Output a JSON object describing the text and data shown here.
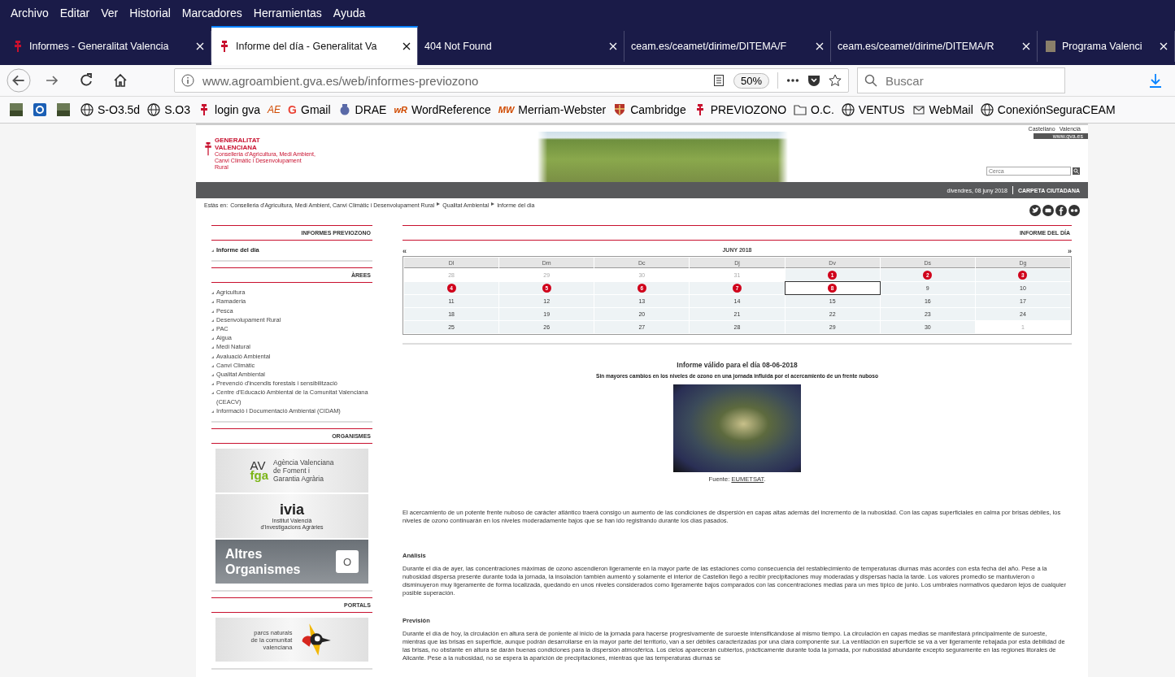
{
  "menu_bar": [
    "Archivo",
    "Editar",
    "Ver",
    "Historial",
    "Marcadores",
    "Herramientas",
    "Ayuda"
  ],
  "tabs": [
    {
      "title": "Informes - Generalitat Valencia",
      "kind": "gva",
      "selected": false
    },
    {
      "title": "Informe del día - Generalitat Va",
      "kind": "gva",
      "selected": true
    },
    {
      "title": "404 Not Found",
      "kind": "plain",
      "selected": false
    },
    {
      "title": "ceam.es/ceamet/dirime/DITEMA/F",
      "kind": "plain",
      "selected": false
    },
    {
      "title": "ceam.es/ceamet/dirime/DITEMA/R",
      "kind": "plain",
      "selected": false
    },
    {
      "title": "Programa Valenci",
      "kind": "page",
      "selected": false
    }
  ],
  "address_bar": {
    "url": "www.agroambient.gva.es/web/informes-previozono",
    "zoom": "50%"
  },
  "search": {
    "placeholder": "Buscar"
  },
  "bookmarks": [
    {
      "kind": "photo"
    },
    {
      "kind": "ring"
    },
    {
      "kind": "photo"
    },
    {
      "label": "S-O3.5d",
      "kind": "globe"
    },
    {
      "label": "S.O3",
      "kind": "globe"
    },
    {
      "label": "login gva",
      "kind": "gva"
    },
    {
      "label": "Gmail",
      "kind": "logo",
      "logo_text": "G"
    },
    {
      "label": "DRAE",
      "kind": "crest"
    },
    {
      "label": "WordReference",
      "kind": "logo",
      "logo_text": "wR"
    },
    {
      "label": "Merriam-Webster",
      "kind": "logo",
      "logo_text": "MW"
    },
    {
      "label": "Cambridge",
      "kind": "shield"
    },
    {
      "label": "PREVIOZONO",
      "kind": "gva"
    },
    {
      "label": "O.C.",
      "kind": "folder"
    },
    {
      "label": "VENTUS",
      "kind": "globe"
    },
    {
      "label": "WebMail",
      "kind": "mail"
    },
    {
      "label": "ConexiónSeguraCEAM",
      "kind": "globe"
    }
  ],
  "ae_bookmark": "AE",
  "page": {
    "languages": [
      "Castellano",
      "Valencià"
    ],
    "site_link": "www.gva.es",
    "logo": {
      "name_lines": [
        "GENERALITAT",
        "VALENCIANA"
      ],
      "department": "Conselleria d'Agricultura, Medi Ambient, Canvi Climàtic i Desenvolupament Rural"
    },
    "search_placeholder": "Cerca",
    "date": "divendres, 08 juny 2018",
    "citizen_link": "CARPETA CIUTADANA",
    "breadcrumb": {
      "label": "Estàs en:",
      "items": [
        "Conselleria d'Agricultura, Medi Ambient, Canvi Climàtic i Desenvolupament Rural",
        "Qualitat Ambiental",
        "Informe del dia"
      ]
    },
    "sidebar": [
      {
        "title": "INFORMES PREVIOZONO",
        "kind": "links",
        "items": [
          {
            "label": "Informe del dia",
            "selected": true
          }
        ]
      },
      {
        "title": "ÀREES",
        "kind": "links",
        "items": [
          {
            "label": "Agricultura",
            "selected": false
          },
          {
            "label": "Ramaderia",
            "selected": false
          },
          {
            "label": "Pesca",
            "selected": false
          },
          {
            "label": "Desenvolupament Rural",
            "selected": false
          },
          {
            "label": "PAC",
            "selected": false
          },
          {
            "label": "Aigua",
            "selected": false
          },
          {
            "label": "Medi Natural",
            "selected": false
          },
          {
            "label": "Avaluació Ambiental",
            "selected": false
          },
          {
            "label": "Canvi Climàtic",
            "selected": false
          },
          {
            "label": "Qualitat Ambiental",
            "selected": false
          },
          {
            "label": "Prevenció d'incendis forestals i sensibilització",
            "selected": false
          },
          {
            "label": "Centre d'Educació Ambiental de la Comunitat Valenciana (CEACV)",
            "selected": false
          },
          {
            "label": "Informació i Documentació Ambiental (CIDAM)",
            "selected": false
          }
        ]
      },
      {
        "title": "ORGANISMES",
        "kind": "banners",
        "items": [
          {
            "kind": "avfga",
            "mark_top": "AV",
            "mark_bottom": "fga",
            "lines": [
              "Agència Valenciana",
              "de Foment i",
              "Garantia Agrària"
            ]
          },
          {
            "kind": "ivia",
            "mark_top": "ivia",
            "lines": [
              "Institut Valencià",
              "d'Investigacions Agràries"
            ]
          },
          {
            "kind": "others",
            "lines": [
              "Altres",
              "Organismes"
            ],
            "badge": "O"
          }
        ]
      },
      {
        "title": "PORTALS",
        "kind": "banners",
        "items": [
          {
            "kind": "parks",
            "lines": [
              "parcs naturals",
              "de la comunitat",
              "valenciana"
            ]
          }
        ]
      }
    ],
    "calendar": {
      "title": "INFORME DEL DÍA",
      "prev": "«",
      "next": "»",
      "month": "JUNY 2018",
      "weekdays": [
        "Dl",
        "Dm",
        "Dc",
        "Dj",
        "Dv",
        "Ds",
        "Dg"
      ],
      "weeks": [
        [
          {
            "day": "28",
            "kind": "outside",
            "selected": false
          },
          {
            "day": "29",
            "kind": "outside",
            "selected": false
          },
          {
            "day": "30",
            "kind": "outside",
            "selected": false
          },
          {
            "day": "31",
            "kind": "outside",
            "selected": false
          },
          {
            "day": "1",
            "kind": "report",
            "selected": false
          },
          {
            "day": "2",
            "kind": "report",
            "selected": false
          },
          {
            "day": "3",
            "kind": "report",
            "selected": false
          }
        ],
        [
          {
            "day": "4",
            "kind": "report",
            "selected": false
          },
          {
            "day": "5",
            "kind": "report",
            "selected": false
          },
          {
            "day": "6",
            "kind": "report",
            "selected": false
          },
          {
            "day": "7",
            "kind": "report",
            "selected": false
          },
          {
            "day": "8",
            "kind": "report",
            "selected": true
          },
          {
            "day": "9",
            "kind": "plain",
            "selected": false
          },
          {
            "day": "10",
            "kind": "plain",
            "selected": false
          }
        ],
        [
          {
            "day": "11",
            "kind": "plain",
            "selected": false
          },
          {
            "day": "12",
            "kind": "plain",
            "selected": false
          },
          {
            "day": "13",
            "kind": "plain",
            "selected": false
          },
          {
            "day": "14",
            "kind": "plain",
            "selected": false
          },
          {
            "day": "15",
            "kind": "plain",
            "selected": false
          },
          {
            "day": "16",
            "kind": "plain",
            "selected": false
          },
          {
            "day": "17",
            "kind": "plain",
            "selected": false
          }
        ],
        [
          {
            "day": "18",
            "kind": "plain",
            "selected": false
          },
          {
            "day": "19",
            "kind": "plain",
            "selected": false
          },
          {
            "day": "20",
            "kind": "plain",
            "selected": false
          },
          {
            "day": "21",
            "kind": "plain",
            "selected": false
          },
          {
            "day": "22",
            "kind": "plain",
            "selected": false
          },
          {
            "day": "23",
            "kind": "plain",
            "selected": false
          },
          {
            "day": "24",
            "kind": "plain",
            "selected": false
          }
        ],
        [
          {
            "day": "25",
            "kind": "plain",
            "selected": false
          },
          {
            "day": "26",
            "kind": "plain",
            "selected": false
          },
          {
            "day": "27",
            "kind": "plain",
            "selected": false
          },
          {
            "day": "28",
            "kind": "plain",
            "selected": false
          },
          {
            "day": "29",
            "kind": "plain",
            "selected": false
          },
          {
            "day": "30",
            "kind": "plain",
            "selected": false
          },
          {
            "day": "1",
            "kind": "outside",
            "selected": false
          }
        ]
      ]
    },
    "report": {
      "title": "Informe válido para el día 08-06-2018",
      "subtitle": "Sin mayores cambios en los niveles de ozono en una jornada influida por el acercamiento de un frente nuboso",
      "source_label": "Fuente:",
      "source_link": "EUMETSAT",
      "source_end": ".",
      "intro": "El acercamiento de un potente frente nuboso de carácter atlántico traerá consigo un aumento de las condiciones de dispersión en capas altas además del incremento de la nubosidad. Con las capas superficiales en calma por brisas débiles, los niveles de ozono continuarán en los niveles moderadamente bajos que se han ido registrando durante los días pasados.",
      "sections": [
        {
          "heading": "Análisis",
          "text": "Durante el día de ayer, las concentraciones máximas de ozono ascendieron ligeramente en la mayor parte de las estaciones como consecuencia del restablecimiento de temperaturas diurnas más acordes con esta fecha del año. Pese a la nubosidad dispersa presente durante toda la jornada, la insolación también aumentó y solamente el interior de Castellón llegó a recibir precipitaciones muy moderadas y dispersas hacia la tarde. Los valores promedio se mantuvieron o disminuyeron muy ligeramente de forma localizada, quedando en unos niveles considerados como ligeramente bajos comparados con las concentraciones medias para un mes típico de junio. Los umbrales normativos quedaron lejos de cualquier posible superación."
        },
        {
          "heading": "Previsión",
          "text": "Durante el día de hoy, la circulación en altura será de poniente al inicio de la jornada para hacerse progresivamente de suroeste intensificándose al mismo tiempo. La circulación en capas medias se manifestará principalmente de suroeste, mientras que las brisas en superficie, aunque podrán desarrollarse en la mayor parte del territorio, van a ser débiles caracterizadas por una clara componente sur. La ventilación en superficie se va a ver ligeramente rebajada por esta debilidad de las brisas, no obstante en altura se darán buenas condiciones para la dispersión atmosférica. Los cielos aparecerán cubiertos, prácticamente durante toda la jornada, por nubosidad abundante excepto seguramente en las regiones litorales de Alicante. Pese a la nubosidad, no se espera la aparición de precipitaciones, mientras que las temperaturas diurnas se"
        }
      ]
    }
  }
}
